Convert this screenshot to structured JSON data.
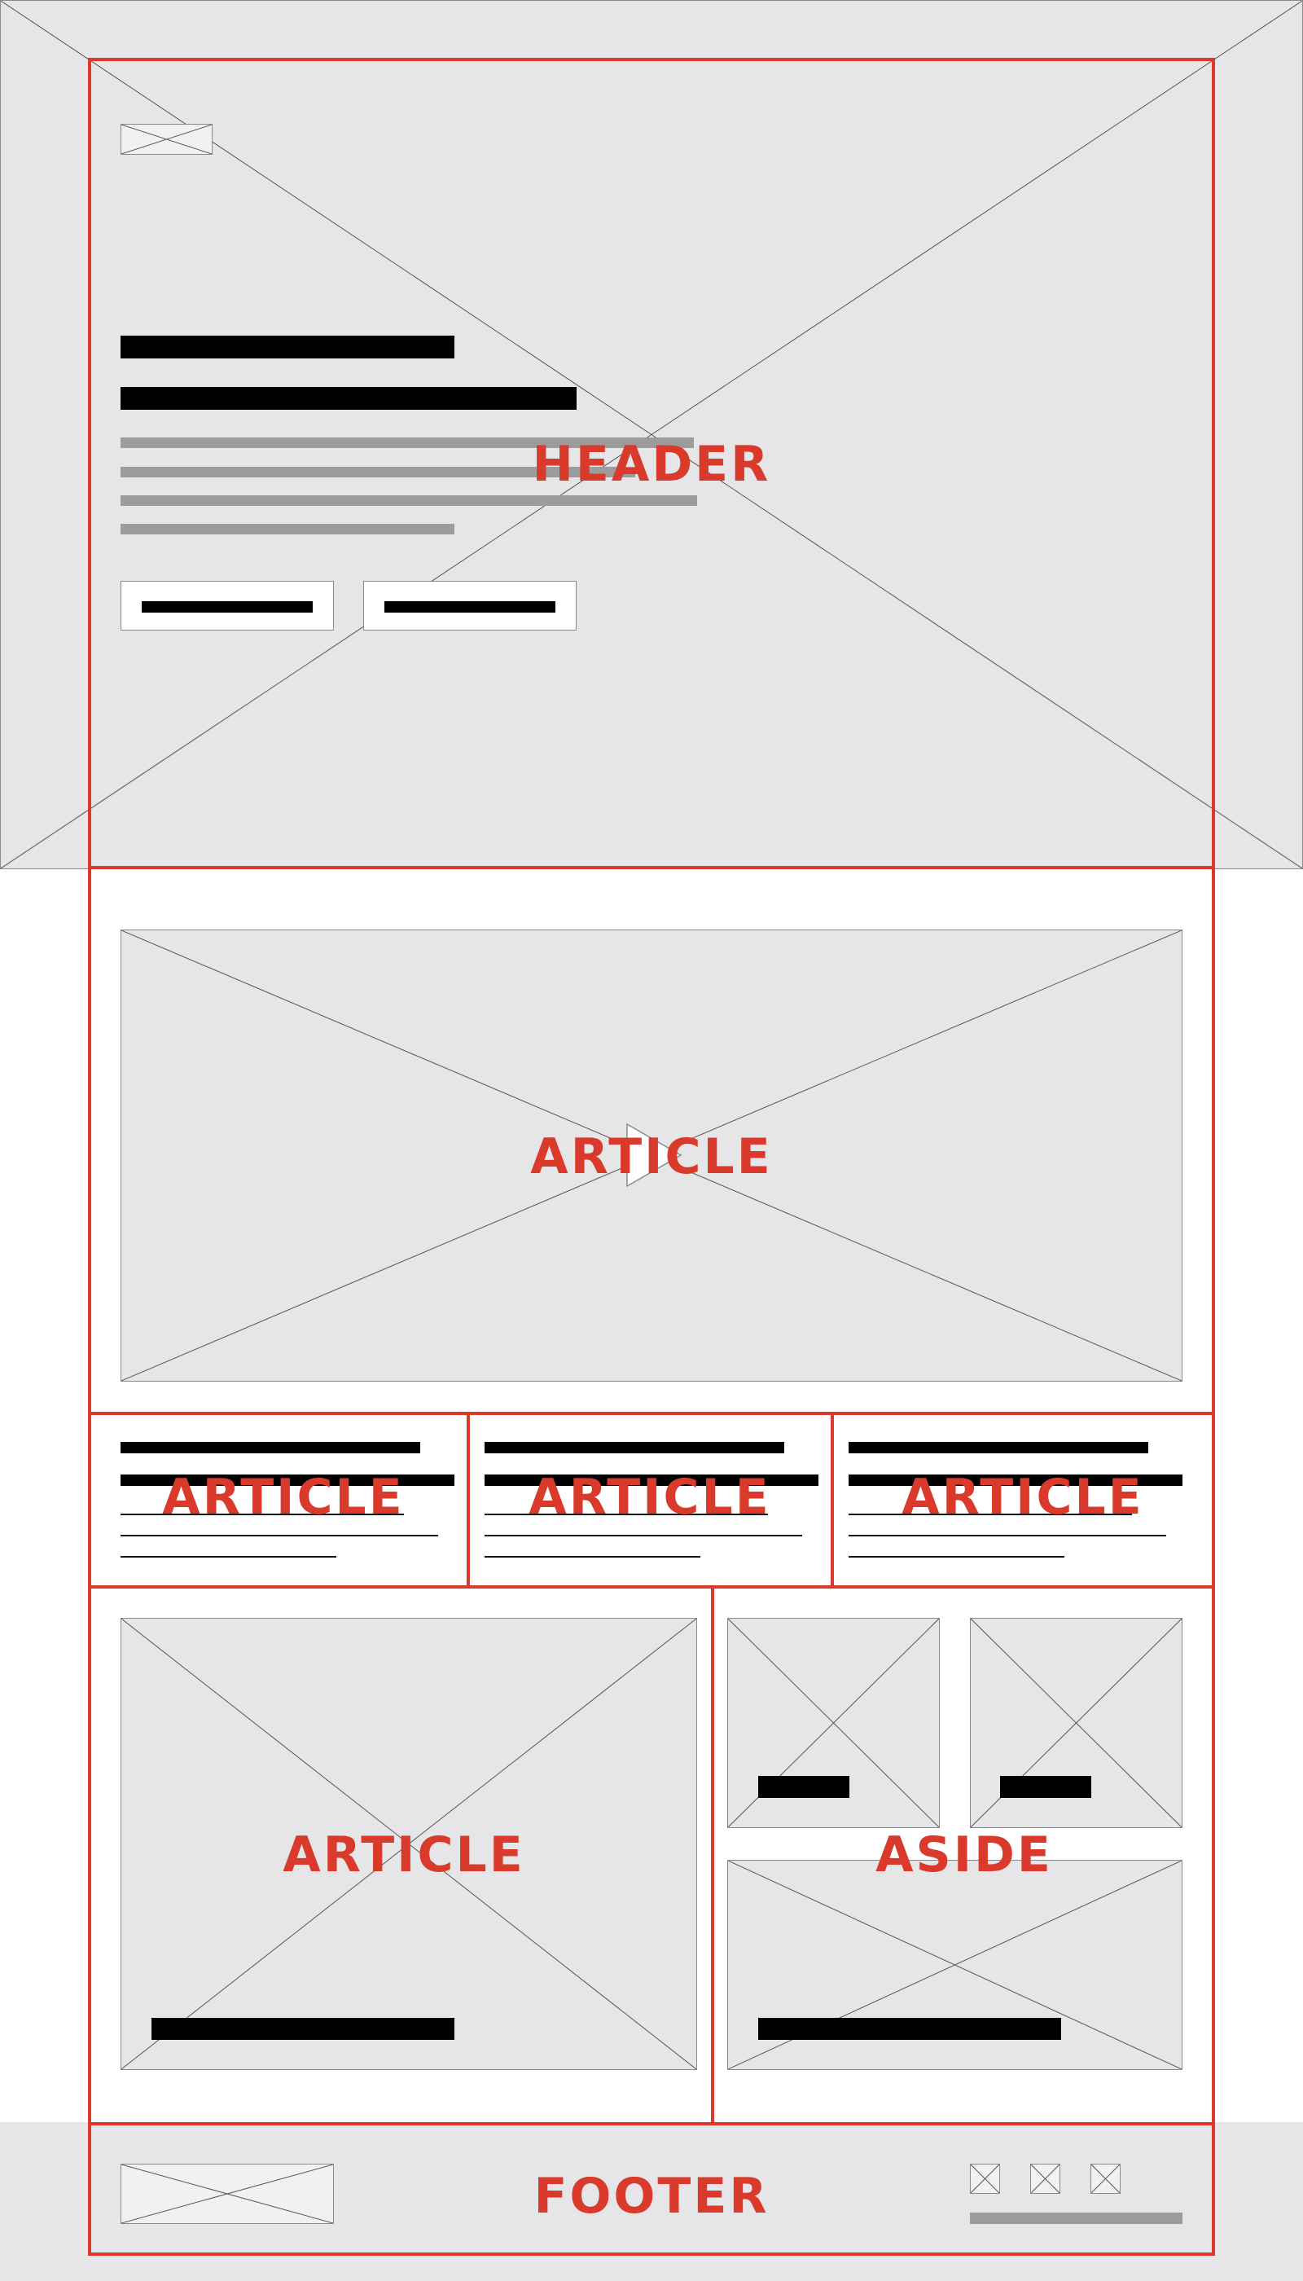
{
  "sections": {
    "header": "HEADER",
    "article_video": "ARTICLE",
    "article_cards": [
      "ARTICLE",
      "ARTICLE",
      "ARTICLE"
    ],
    "article_feature": "ARTICLE",
    "aside": "ASIDE",
    "footer": "FOOTER"
  },
  "icons": {
    "image_placeholder": "image-placeholder-icon",
    "play": "play-icon",
    "logo": "logo-placeholder-icon"
  },
  "colors": {
    "region_outline": "#d93a2b",
    "placeholder_fill": "#e6e6e8",
    "text_bar": "#000000",
    "secondary_bar": "#9c9c9c"
  }
}
